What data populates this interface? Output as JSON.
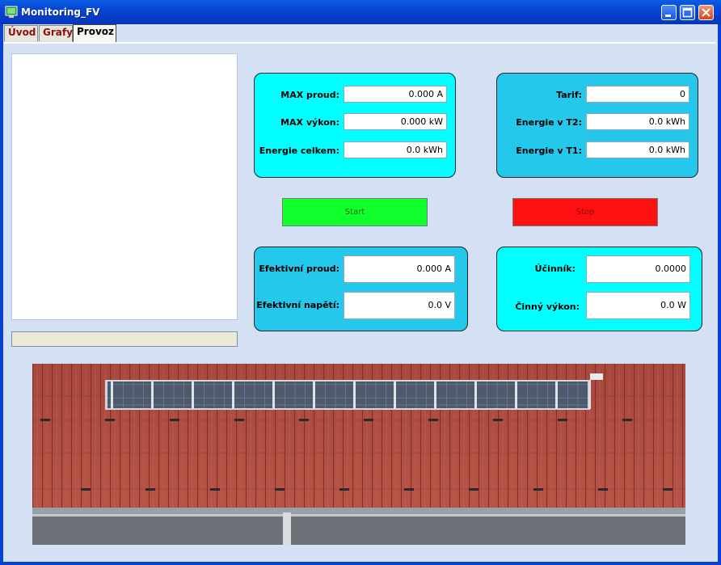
{
  "window": {
    "title": "Monitoring_FV",
    "icon": "monitor-app-icon"
  },
  "tabs": [
    {
      "label": "Úvod"
    },
    {
      "label": "Grafy"
    },
    {
      "label": "Provoz",
      "active": true
    }
  ],
  "panel_top_left": {
    "rows": [
      {
        "label": "MAX proud:",
        "value": "0.000 A"
      },
      {
        "label": "MAX výkon:",
        "value": "0.000 kW"
      },
      {
        "label": "Energie celkem:",
        "value": "0.0 kWh"
      }
    ]
  },
  "panel_top_right": {
    "rows": [
      {
        "label": "Tarif:",
        "value": "0"
      },
      {
        "label": "Energie v T2:",
        "value": "0.0 kWh"
      },
      {
        "label": "Energie v T1:",
        "value": "0.0 kWh"
      }
    ]
  },
  "buttons": {
    "start": "Start",
    "stop": "Stop"
  },
  "panel_bottom_left": {
    "rows": [
      {
        "label": "Efektivní proud:",
        "value": "0.000 A"
      },
      {
        "label": "Efektivní napětí:",
        "value": "0.0 V"
      }
    ]
  },
  "panel_bottom_right": {
    "rows": [
      {
        "label": "Účinník:",
        "value": "0.0000"
      },
      {
        "label": "Činný výkon:",
        "value": "0.0 W"
      }
    ]
  },
  "colors": {
    "panel_cyan": "#00ffff",
    "panel_blue": "#24c8ea",
    "start": "#11ff2c",
    "stop": "#ff1010"
  }
}
